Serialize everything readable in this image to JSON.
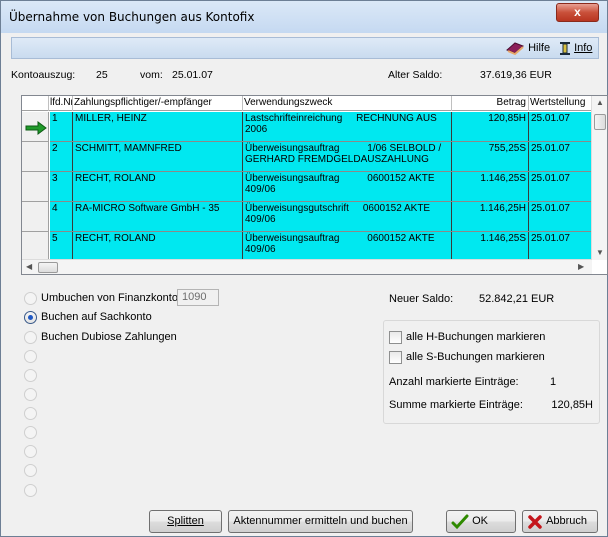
{
  "window": {
    "title": "Übernahme von Buchungen aus Kontofix",
    "close_label": "x"
  },
  "toolbar": {
    "help_label": "Hilfe",
    "info_label": "Info"
  },
  "header": {
    "kontoauszug_label": "Kontoauszug:",
    "kontoauszug_value": "25",
    "vom_label": "vom:",
    "vom_value": "25.01.07",
    "alter_saldo_label": "Alter Saldo:",
    "alter_saldo_value": "37.619,36 EUR"
  },
  "table": {
    "columns": [
      "lfd.Nr.",
      "Zahlungspflichtiger/-empfänger",
      "Verwendungszweck",
      "Betrag",
      "Wertstellung"
    ],
    "rows": [
      {
        "nr": "1",
        "name": "MILLER, HEINZ",
        "zweck1": "Lastschrifteinreichung     RECHNUNG AUS",
        "zweck2": "2006",
        "betrag": "120,85H",
        "datum": "25.01.07",
        "current": true
      },
      {
        "nr": "2",
        "name": "SCHMITT, MAMNFRED",
        "zweck1": "Überweisungsauftrag          1/06 SELBOLD /",
        "zweck2": "GERHARD FREMDGELDAUSZAHLUNG",
        "betrag": "755,25S",
        "datum": "25.01.07",
        "current": false
      },
      {
        "nr": "3",
        "name": "RECHT, ROLAND",
        "zweck1": "Überweisungsauftrag          0600152 AKTE",
        "zweck2": "409/06",
        "betrag": "1.146,25S",
        "datum": "25.01.07",
        "current": false
      },
      {
        "nr": "4",
        "name": "RA-MICRO Software GmbH - 35",
        "zweck1": "Überweisungsgutschrift     0600152 AKTE",
        "zweck2": "409/06",
        "betrag": "1.146,25H",
        "datum": "25.01.07",
        "current": false
      },
      {
        "nr": "5",
        "name": "RECHT, ROLAND",
        "zweck1": "Überweisungsauftrag          0600152 AKTE",
        "zweck2": "409/06",
        "betrag": "1.146,25S",
        "datum": "25.01.07",
        "current": false
      }
    ]
  },
  "options": {
    "umbuchen_label": "Umbuchen von Finanzkonto:",
    "umbuchen_value": "1090",
    "sachkonto_label": "Buchen auf Sachkonto",
    "dubiose_label": "Buchen Dubiose Zahlungen"
  },
  "summary": {
    "neuer_saldo_label": "Neuer Saldo:",
    "neuer_saldo_value": "52.842,21 EUR",
    "alle_h_label": "alle H-Buchungen markieren",
    "alle_s_label": "alle S-Buchungen markieren",
    "anzahl_label": "Anzahl markierte Einträge:",
    "anzahl_value": "1",
    "summe_label": "Summe markierte Einträge:",
    "summe_value": "120,85H"
  },
  "buttons": {
    "splitten": "Splitten",
    "akten": "Aktennummer ermitteln und buchen",
    "ok": "OK",
    "abbruch": "Abbruch"
  },
  "colors": {
    "row_highlight": "#00e8f0",
    "ok_green": "#2f8a00",
    "cancel_red": "#c4161c"
  }
}
